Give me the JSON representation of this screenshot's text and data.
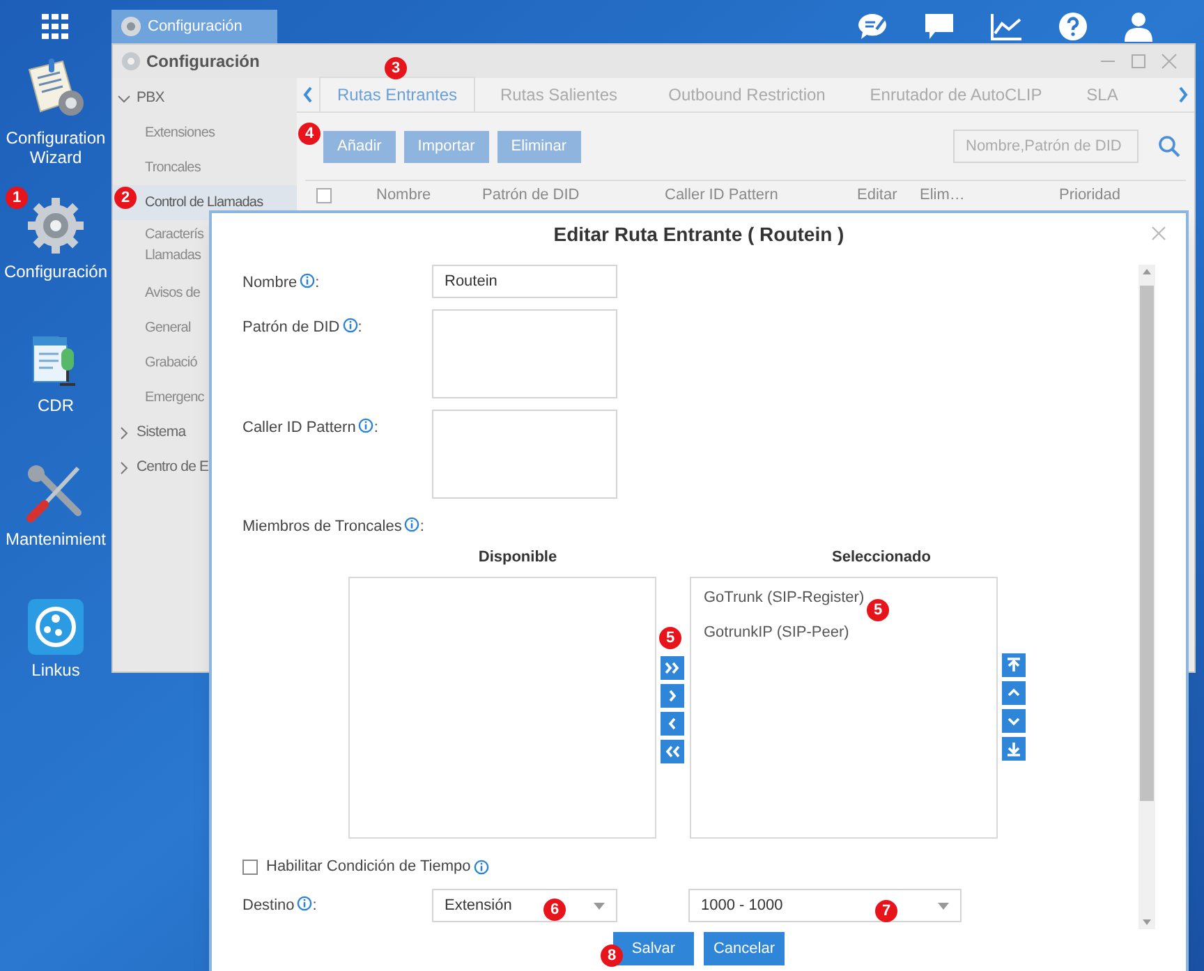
{
  "desktop_icons": [
    {
      "label_lines": [
        "Configuration",
        "Wizard"
      ]
    },
    {
      "label_lines": [
        "Configuración"
      ]
    },
    {
      "label_lines": [
        "CDR"
      ]
    },
    {
      "label_lines": [
        "Mantenimient"
      ]
    },
    {
      "label_lines": [
        "Linkus"
      ]
    }
  ],
  "taskbar": {
    "tab": "Configuración"
  },
  "window": {
    "title": "Configuración",
    "sidebar": [
      {
        "label": "PBX",
        "expanded": true,
        "children": [
          {
            "lines": [
              "Extensiones"
            ],
            "selected": false
          },
          {
            "lines": [
              "Troncales"
            ],
            "selected": false
          },
          {
            "lines": [
              "Control de Llamadas"
            ],
            "selected": true
          },
          {
            "lines": [
              "Caracterís",
              "Llamadas"
            ],
            "selected": false
          },
          {
            "lines": [
              "Avisos de"
            ],
            "selected": false
          },
          {
            "lines": [
              "General"
            ],
            "selected": false
          },
          {
            "lines": [
              "Grabació"
            ],
            "selected": false
          },
          {
            "lines": [
              "Emergenc"
            ],
            "selected": false
          }
        ]
      },
      {
        "label": "Sistema",
        "expanded": false
      },
      {
        "label": "Centro de E",
        "expanded": false
      }
    ],
    "tabs": [
      {
        "label": "Rutas Entrantes",
        "selected": true
      },
      {
        "label": "Rutas Salientes",
        "selected": false
      },
      {
        "label": "Outbound Restriction",
        "selected": false
      },
      {
        "label": "Enrutador de AutoCLIP",
        "selected": false
      },
      {
        "label": "SLA",
        "selected": false
      }
    ],
    "toolbar": {
      "buttons": [
        "Añadir",
        "Importar",
        "Eliminar"
      ],
      "search": {
        "placeholder": "Nombre,Patrón de DID"
      }
    },
    "table": {
      "select_all_checked": false,
      "columns": [
        "Nombre",
        "Patrón de DID",
        "Caller ID Pattern",
        "Editar",
        "Elim…",
        "Prioridad"
      ]
    }
  },
  "dialog": {
    "title": "Editar Ruta Entrante ( Routein )",
    "fields": [
      {
        "kind": "text",
        "label": "Nombre",
        "suffix": ":",
        "value": "Routein"
      },
      {
        "kind": "textarea",
        "label": "Patrón de DID",
        "suffix": ":"
      },
      {
        "kind": "textarea",
        "label": "Caller ID Pattern",
        "suffix": ":"
      }
    ],
    "trunks": {
      "label": "Miembros de Troncales",
      "suffix": ":",
      "available_heading": "Disponible",
      "selected_heading": "Seleccionado",
      "selected": [
        "GoTrunk (SIP-Register)",
        "GotrunkIP (SIP-Peer)"
      ]
    },
    "time_condition": {
      "label": "Habilitar Condición de Tiempo",
      "checked": false
    },
    "destination": {
      "label": "Destino",
      "suffix": ":",
      "type": "Extensión",
      "target": "1000 - 1000"
    },
    "buttons": [
      "Salvar",
      "Cancelar"
    ]
  },
  "callouts": [
    "1",
    "2",
    "3",
    "4",
    "5",
    "5",
    "6",
    "7",
    "8"
  ]
}
